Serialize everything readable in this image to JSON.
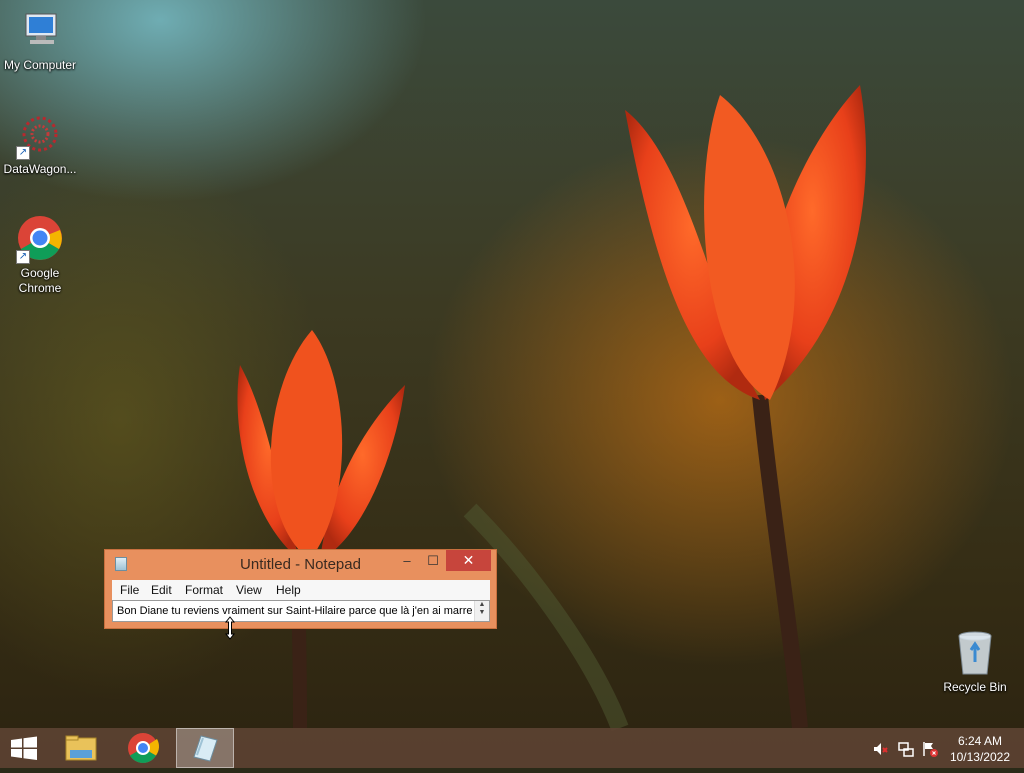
{
  "desktop": {
    "icons": [
      {
        "label": "My Computer",
        "icon": "computer-icon"
      },
      {
        "label": "DataWagon...",
        "icon": "datawagon-icon"
      },
      {
        "label": "Google Chrome",
        "icon": "chrome-icon"
      },
      {
        "label": "Recycle Bin",
        "icon": "recycle-bin-icon"
      }
    ]
  },
  "notepad": {
    "title": "Untitled - Notepad",
    "menu": [
      "File",
      "Edit",
      "Format",
      "View",
      "Help"
    ],
    "content": "Bon Diane tu reviens vraiment sur Saint-Hilaire parce que là j'en ai marre",
    "buttons": {
      "minimize": "–",
      "maximize": "☐",
      "close": "✕"
    }
  },
  "taskbar": {
    "items": [
      {
        "name": "start",
        "icon": "windows-start-icon"
      },
      {
        "name": "file-explorer",
        "icon": "folder-icon"
      },
      {
        "name": "google-chrome",
        "icon": "chrome-icon"
      },
      {
        "name": "notepad",
        "icon": "notepad-icon",
        "active": true
      }
    ],
    "tray": [
      "volume-muted-icon",
      "network-icon",
      "action-center-flag-icon"
    ],
    "clock": {
      "time": "6:24 AM",
      "date": "10/13/2022"
    }
  },
  "colors": {
    "notepad_frame": "#e8905e",
    "close_button": "#c7453c",
    "taskbar": "#5c4232"
  }
}
